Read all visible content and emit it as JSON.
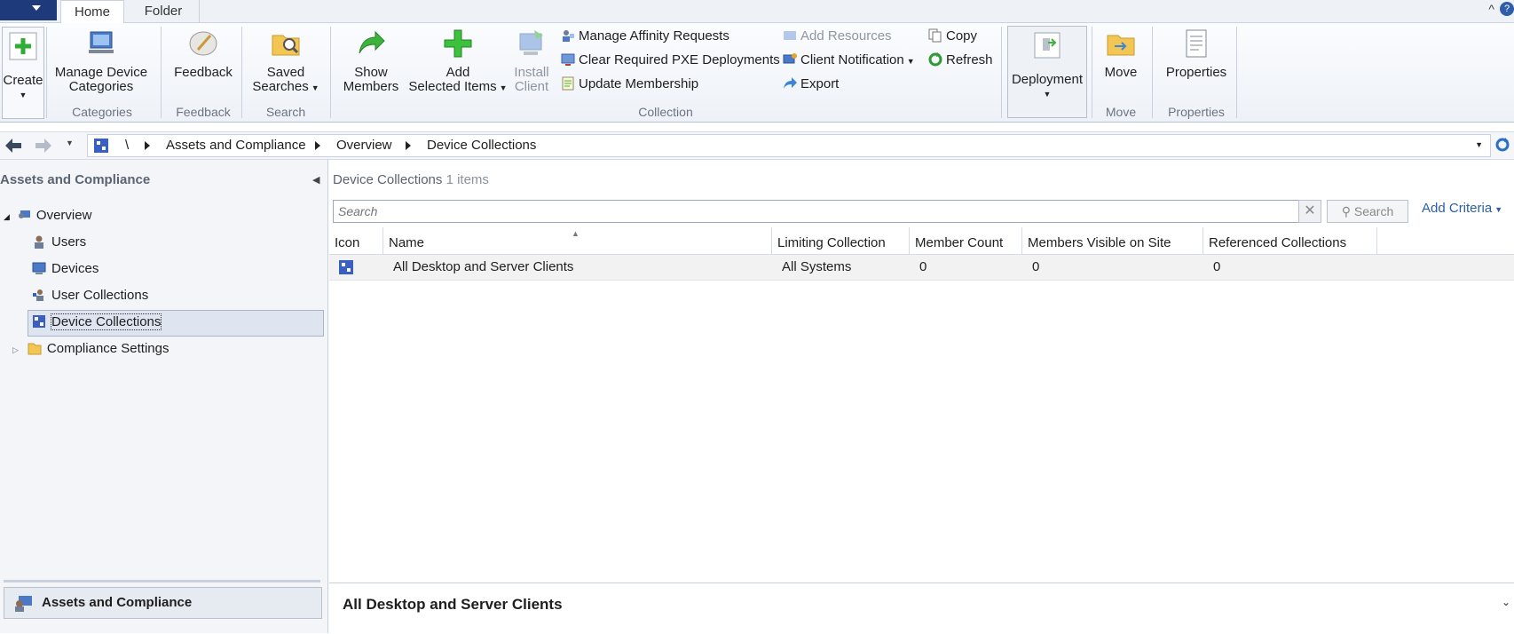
{
  "tabs": [
    "Home",
    "Folder"
  ],
  "ribbon": {
    "create": "Create",
    "manage_device_categories": [
      "Manage Device",
      "Categories"
    ],
    "feedback": "Feedback",
    "saved_searches": [
      "Saved",
      "Searches"
    ],
    "show_members": [
      "Show",
      "Members"
    ],
    "add_selected_items": [
      "Add",
      "Selected Items"
    ],
    "install_client": [
      "Install",
      "Client"
    ],
    "manage_affinity": "Manage Affinity Requests",
    "clear_pxe": "Clear Required PXE Deployments",
    "update_membership": "Update Membership",
    "add_resources": "Add Resources",
    "client_notification": "Client Notification",
    "export": "Export",
    "copy": "Copy",
    "refresh": "Refresh",
    "deployment": "Deployment",
    "move": "Move",
    "properties": "Properties",
    "groups": [
      "Categories",
      "Feedback",
      "Search",
      "Collection",
      "Move",
      "Properties"
    ]
  },
  "breadcrumb": [
    "\\",
    "Assets and Compliance",
    "Overview",
    "Device Collections"
  ],
  "nav": {
    "title": "Assets and Compliance",
    "items": [
      {
        "label": "Overview",
        "icon": "overview-icon"
      },
      {
        "label": "Users",
        "icon": "user-icon"
      },
      {
        "label": "Devices",
        "icon": "devices-icon"
      },
      {
        "label": "User Collections",
        "icon": "user-collections-icon"
      },
      {
        "label": "Device Collections",
        "icon": "device-collections-icon"
      },
      {
        "label": "Compliance Settings",
        "icon": "folder-icon"
      }
    ],
    "workspace": "Assets and Compliance"
  },
  "list": {
    "title": "Device Collections",
    "count": "1 items",
    "search_placeholder": "Search",
    "search_button": "Search",
    "add_criteria": "Add Criteria",
    "columns": [
      "Icon",
      "Name",
      "Limiting Collection",
      "Member Count",
      "Members Visible on Site",
      "Referenced Collections"
    ],
    "rows": [
      {
        "name": "All Desktop and Server Clients",
        "limiting": "All Systems",
        "member_count": "0",
        "visible": "0",
        "referenced": "0"
      }
    ]
  },
  "detail": {
    "title": "All Desktop and Server Clients"
  },
  "colors": {
    "accent": "#2a5ea8",
    "app_menu": "#1e3a7a",
    "green": "#3cb43c"
  }
}
